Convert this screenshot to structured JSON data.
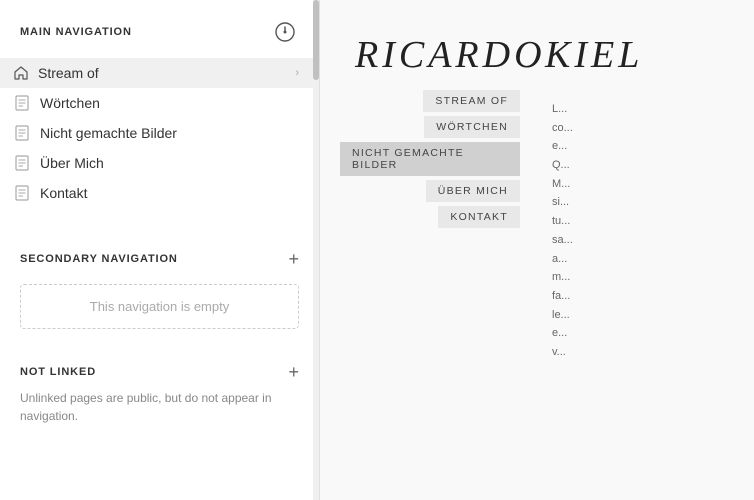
{
  "leftPanel": {
    "mainNav": {
      "title": "MAIN NAVIGATION",
      "settingsIconLabel": "settings-icon",
      "items": [
        {
          "label": "Stream of",
          "type": "home",
          "hasChevron": true
        },
        {
          "label": "Wörtchen",
          "type": "page",
          "hasChevron": false
        },
        {
          "label": "Nicht gemachte Bilder",
          "type": "page",
          "hasChevron": false
        },
        {
          "label": "Über Mich",
          "type": "page",
          "hasChevron": false
        },
        {
          "label": "Kontakt",
          "type": "page",
          "hasChevron": false
        }
      ]
    },
    "secondaryNav": {
      "title": "SECONDARY NAVIGATION",
      "emptyText": "This navigation is empty"
    },
    "notLinked": {
      "title": "NOT LINKED",
      "description": "Unlinked pages are public, but do not appear in navigation."
    }
  },
  "rightPanel": {
    "logoAlt": "Ricardo Kiel handwritten logo",
    "menuItems": [
      {
        "label": "STREAM OF",
        "highlighted": false
      },
      {
        "label": "WÖRTCHEN",
        "highlighted": false
      },
      {
        "label": "NICHT GEMACHTE BILDER",
        "highlighted": false
      },
      {
        "label": "ÜBER MICH",
        "highlighted": false
      },
      {
        "label": "KONTAKT",
        "highlighted": false
      }
    ],
    "bodyTextLines": "L... co... e... Q... M... si... tu... sa... a... m... fa... le... e... v..."
  }
}
